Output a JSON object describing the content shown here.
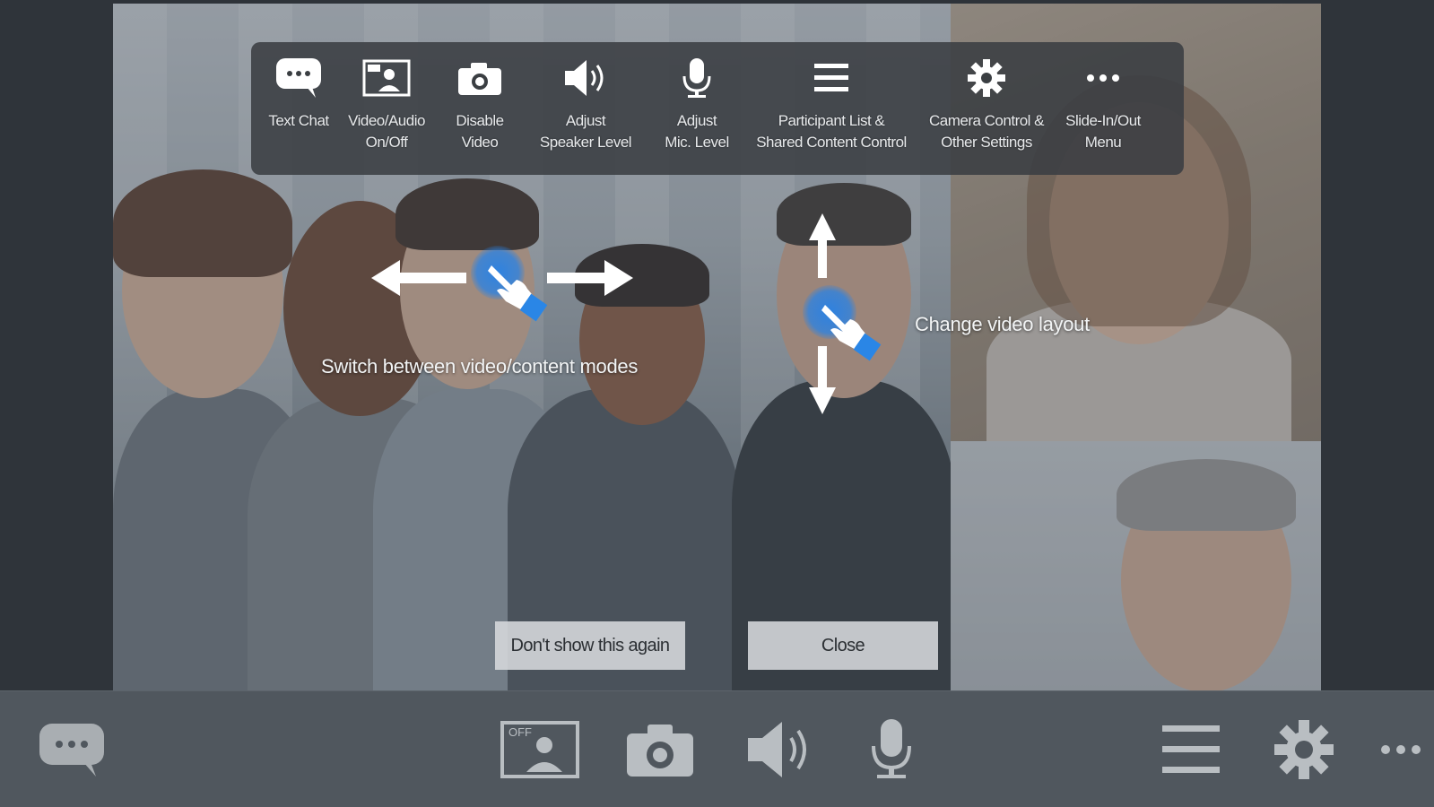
{
  "top_menu": {
    "items": [
      {
        "label": "Text Chat",
        "icon": "chat-bubble-icon"
      },
      {
        "label": "Video/Audio\nOn/Off",
        "icon": "video-audio-toggle-icon"
      },
      {
        "label": "Disable\nVideo",
        "icon": "camera-icon"
      },
      {
        "label": "Adjust\nSpeaker Level",
        "icon": "speaker-icon"
      },
      {
        "label": "Adjust\nMic. Level",
        "icon": "microphone-icon"
      },
      {
        "label": "Participant List &\nShared Content Control",
        "icon": "list-icon"
      },
      {
        "label": "Camera Control &\nOther Settings",
        "icon": "gear-icon"
      },
      {
        "label": "Slide-In/Out\nMenu",
        "icon": "more-dots-icon"
      }
    ]
  },
  "hints": {
    "switch_modes": "Switch between video/content modes",
    "change_layout": "Change video layout"
  },
  "dialog": {
    "dont_show_label": "Don't show this again",
    "close_label": "Close"
  },
  "bottom_bar": {
    "video_toggle_badge": "OFF"
  },
  "colors": {
    "touch_accent": "#2a86e6",
    "toolbar_bg": "#50575e",
    "menu_overlay_bg": "#3a3e42"
  }
}
